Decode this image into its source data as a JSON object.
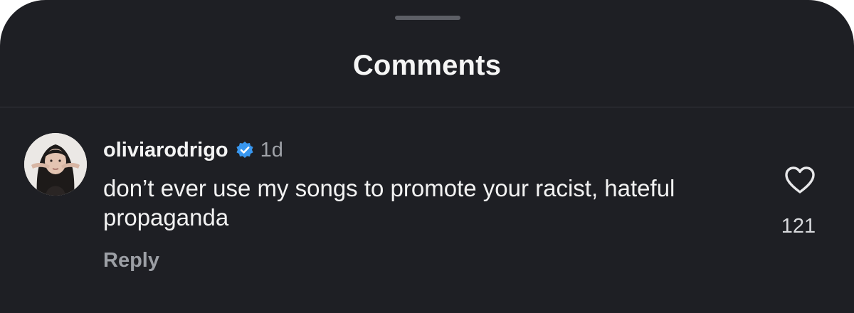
{
  "sheet": {
    "title": "Comments"
  },
  "comment": {
    "username": "oliviarodrigo",
    "verified": true,
    "timestamp": "1d",
    "text": "don’t ever use my songs to promote your racist, hateful propaganda",
    "reply_label": "Reply",
    "like_count": "121"
  },
  "icons": {
    "verified": "verified-badge-icon",
    "like": "heart-outline-icon"
  },
  "colors": {
    "background": "#1e1f24",
    "verified_badge": "#3897f0",
    "secondary_text": "#9fa2a8"
  }
}
